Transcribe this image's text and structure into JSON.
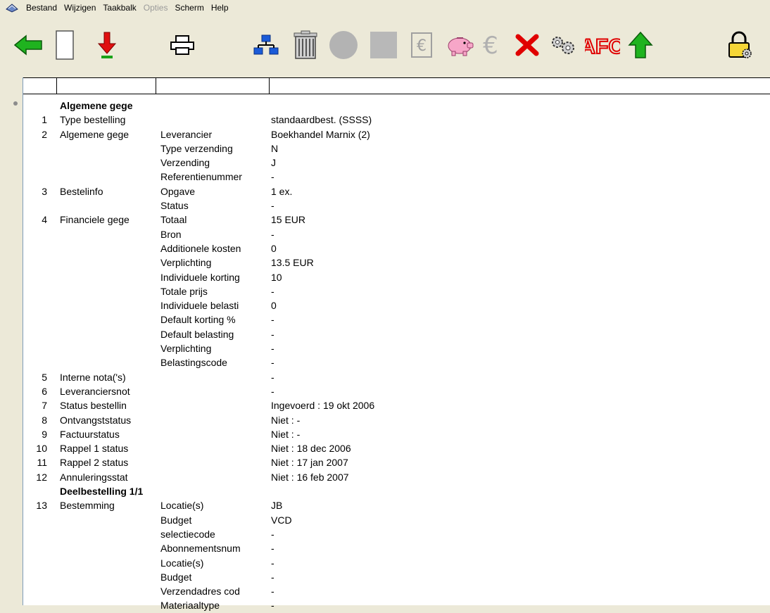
{
  "menu": {
    "items": [
      {
        "label": "Bestand",
        "enabled": true
      },
      {
        "label": "Wijzigen",
        "enabled": true
      },
      {
        "label": "Taakbalk",
        "enabled": true
      },
      {
        "label": "Opties",
        "enabled": false
      },
      {
        "label": "Scherm",
        "enabled": true
      },
      {
        "label": "Help",
        "enabled": true
      }
    ]
  },
  "toolbar": {
    "icons": [
      "back-arrow-icon",
      "blank-page-icon",
      "download-arrow-icon",
      "printer-icon",
      "hierarchy-icon",
      "trash-icon",
      "gray-circle-icon",
      "gray-square-icon",
      "euro-box-icon",
      "piggy-bank-icon",
      "euro-icon",
      "delete-x-icon",
      "gears-icon",
      "afo-icon",
      "up-arrow-icon",
      "lock-icon"
    ],
    "afo_label": "AFO"
  },
  "record": {
    "rows": [
      {
        "num": "",
        "label": "Algemene gege",
        "field": "",
        "value": "",
        "section": true
      },
      {
        "num": "1",
        "label": "Type bestelling",
        "field": "",
        "value": "standaardbest. (SSSS)"
      },
      {
        "num": "2",
        "label": "Algemene gege",
        "field": "Leverancier",
        "value": "Boekhandel Marnix (2)"
      },
      {
        "num": "",
        "label": "",
        "field": "Type verzending",
        "value": "N"
      },
      {
        "num": "",
        "label": "",
        "field": "Verzending",
        "value": "J"
      },
      {
        "num": "",
        "label": "",
        "field": "Referentienummer",
        "value": "-"
      },
      {
        "num": "3",
        "label": "Bestelinfo",
        "field": "Opgave",
        "value": "1 ex."
      },
      {
        "num": "",
        "label": "",
        "field": "Status",
        "value": "-"
      },
      {
        "num": "4",
        "label": "Financiele gege",
        "field": "Totaal",
        "value": "15 EUR"
      },
      {
        "num": "",
        "label": "",
        "field": "Bron",
        "value": "-"
      },
      {
        "num": "",
        "label": "",
        "field": "Additionele kosten",
        "value": "0"
      },
      {
        "num": "",
        "label": "",
        "field": "Verplichting",
        "value": "13.5 EUR"
      },
      {
        "num": "",
        "label": "",
        "field": "Individuele korting",
        "value": "10"
      },
      {
        "num": "",
        "label": "",
        "field": "Totale prijs",
        "value": "-"
      },
      {
        "num": "",
        "label": "",
        "field": "Individuele belasti",
        "value": "0"
      },
      {
        "num": "",
        "label": "",
        "field": "Default korting %",
        "value": "-"
      },
      {
        "num": "",
        "label": "",
        "field": "Default belasting",
        "value": "-"
      },
      {
        "num": "",
        "label": "",
        "field": "Verplichting",
        "value": "-"
      },
      {
        "num": "",
        "label": "",
        "field": "Belastingscode",
        "value": "-"
      },
      {
        "num": "5",
        "label": "Interne nota('s)",
        "field": "",
        "value": "-"
      },
      {
        "num": "6",
        "label": "Leveranciersnot",
        "field": "",
        "value": "-"
      },
      {
        "num": "7",
        "label": "Status bestellin",
        "field": "",
        "value": "Ingevoerd  :  19 okt 2006"
      },
      {
        "num": "8",
        "label": "Ontvangststatus",
        "field": "",
        "value": "Niet  :  -"
      },
      {
        "num": "9",
        "label": "Factuurstatus",
        "field": "",
        "value": "Niet  :  -"
      },
      {
        "num": "10",
        "label": "Rappel 1 status",
        "field": "",
        "value": "Niet  :  18 dec 2006"
      },
      {
        "num": "11",
        "label": "Rappel 2 status",
        "field": "",
        "value": "Niet  :  17 jan 2007"
      },
      {
        "num": "12",
        "label": "Annuleringsstat",
        "field": "",
        "value": "Niet  :  16 feb 2007"
      },
      {
        "num": "",
        "label": "Deelbestelling  1/1",
        "field": "",
        "value": "",
        "section": true
      },
      {
        "num": "13",
        "label": "Bestemming",
        "field": "Locatie(s)",
        "value": "JB"
      },
      {
        "num": "",
        "label": "",
        "field": "Budget",
        "value": "VCD"
      },
      {
        "num": "",
        "label": "",
        "field": "selectiecode",
        "value": "-"
      },
      {
        "num": "",
        "label": "",
        "field": "Abonnementsnum",
        "value": "-"
      },
      {
        "num": "",
        "label": "",
        "field": "Locatie(s)",
        "value": "-"
      },
      {
        "num": "",
        "label": "",
        "field": "Budget",
        "value": "-"
      },
      {
        "num": "",
        "label": "",
        "field": "Verzendadres cod",
        "value": "-"
      },
      {
        "num": "",
        "label": "",
        "field": "Materiaaltype",
        "value": "-"
      }
    ]
  }
}
